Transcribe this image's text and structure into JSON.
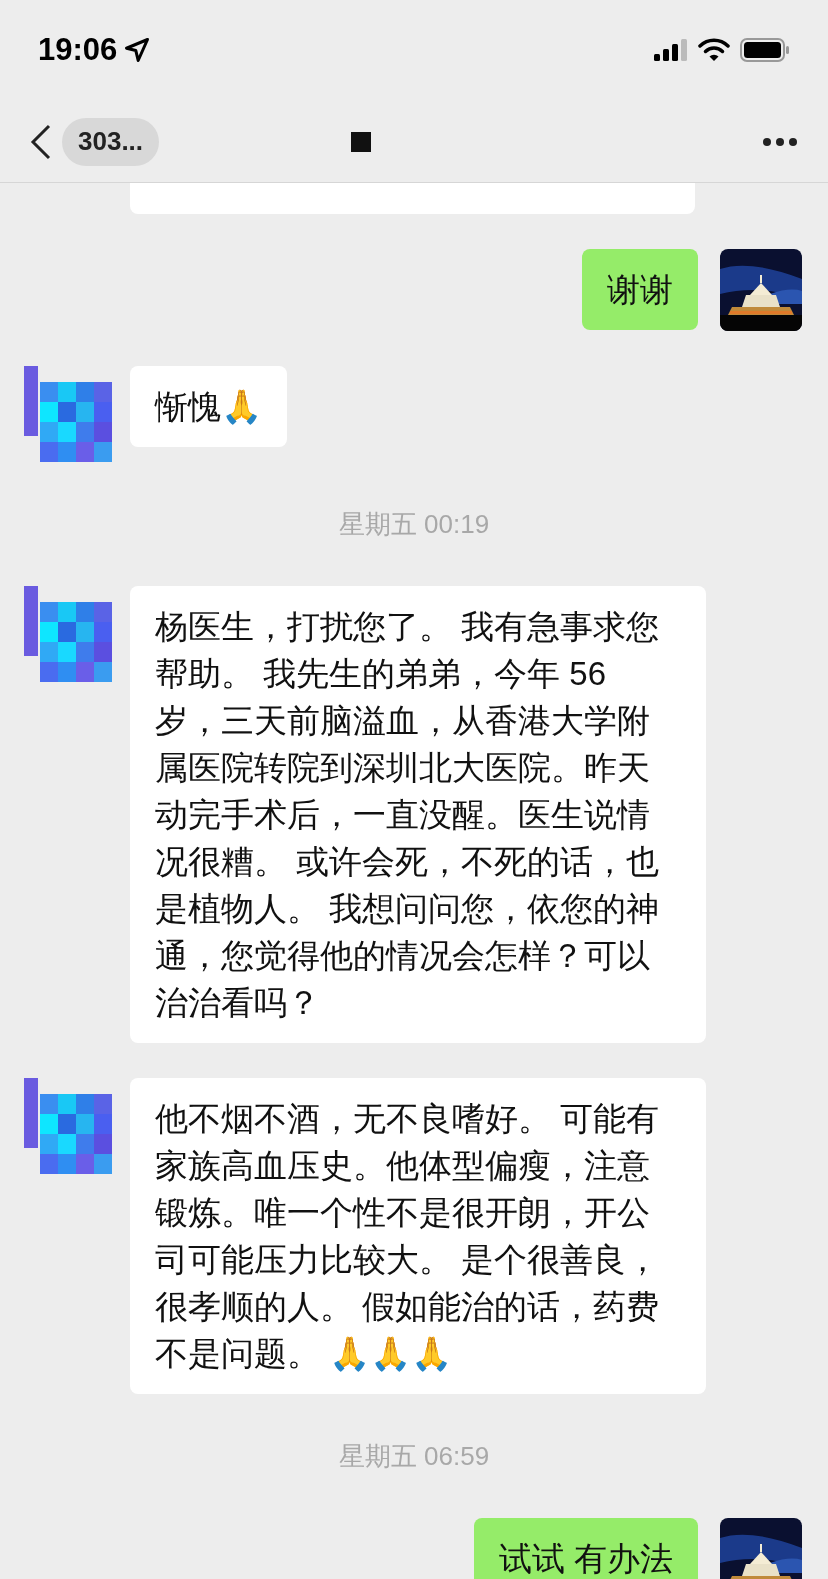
{
  "status_bar": {
    "time": "19:06"
  },
  "nav": {
    "title": "303..."
  },
  "messages": [
    {
      "kind": "outgoing",
      "text": "谢谢"
    },
    {
      "kind": "incoming",
      "text": "惭愧🙏"
    },
    {
      "kind": "time",
      "text": "星期五 00:19"
    },
    {
      "kind": "incoming",
      "text": "杨医生，打扰您了。 我有急事求您帮助。 我先生的弟弟，今年 56 岁，三天前脑溢血，从香港大学附属医院转院到深圳北大医院。昨天动完手术后，一直没醒。医生说情况很糟。 或许会死，不死的话，也是植物人。 我想问问您，依您的神通，您觉得他的情况会怎样？可以治治看吗？"
    },
    {
      "kind": "incoming",
      "text": "他不烟不酒，无不良嗜好。 可能有家族高血压史。他体型偏瘦，注意锻炼。唯一个性不是很开朗，开公司可能压力比较大。 是个很善良，很孝顺的人。 假如能治的话，药费不是问题。 🙏🙏🙏"
    },
    {
      "kind": "time",
      "text": "星期五 06:59"
    },
    {
      "kind": "outgoing",
      "text": "试试 有办法"
    }
  ]
}
